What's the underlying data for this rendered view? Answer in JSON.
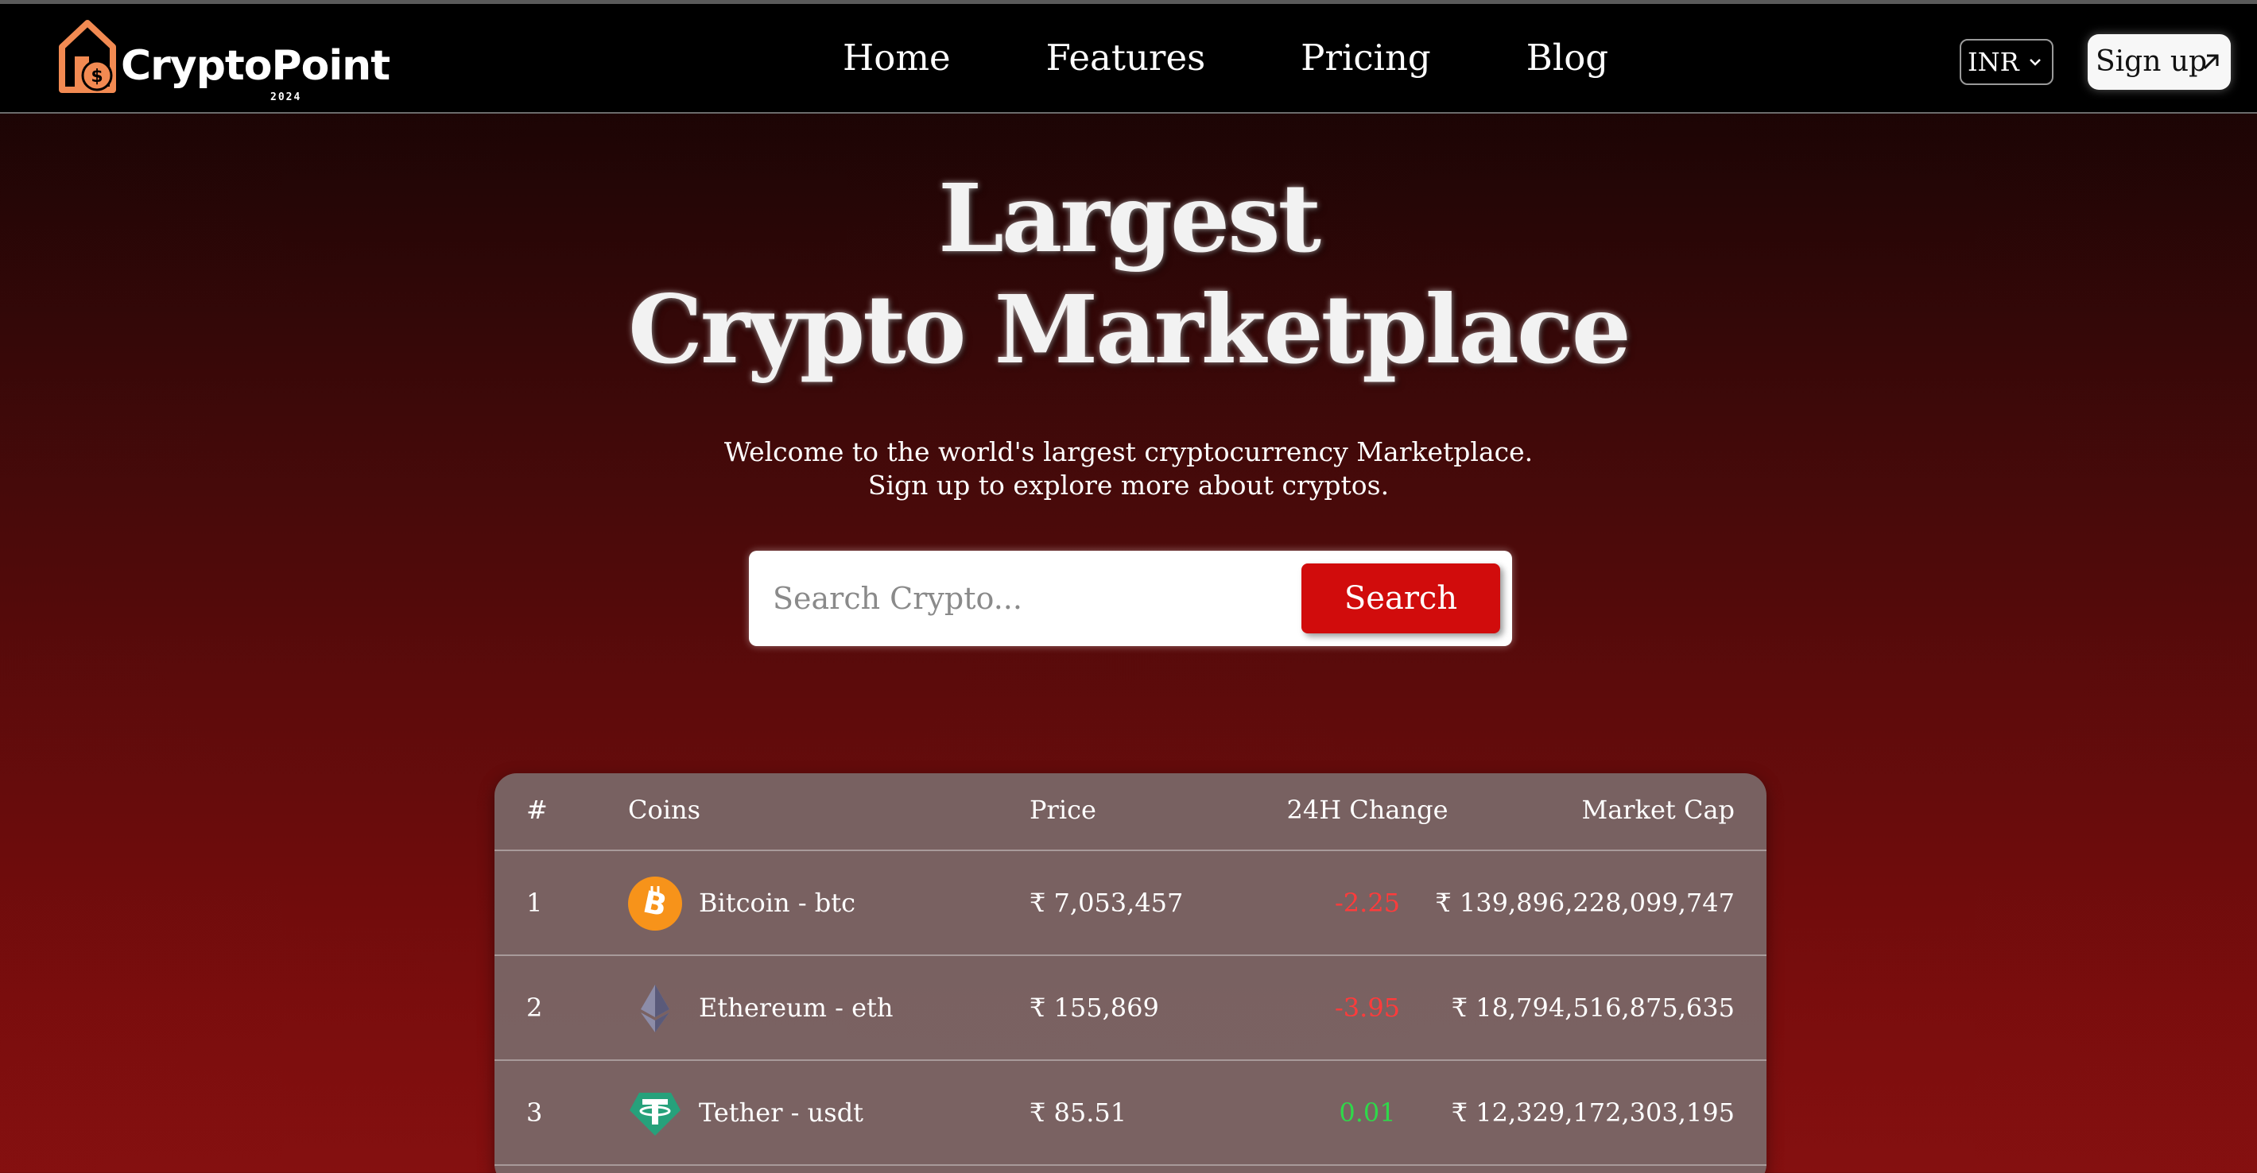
{
  "brand": {
    "name": "CryptoPoint",
    "year": "2024",
    "accent": "#f28a52"
  },
  "nav": {
    "links": [
      "Home",
      "Features",
      "Pricing",
      "Blog"
    ],
    "currency": "INR",
    "signup_label": "Sign up"
  },
  "hero": {
    "title_line1": "Largest",
    "title_line2": "Crypto Marketplace",
    "subtitle_line1": "Welcome to the world's largest cryptocurrency Marketplace.",
    "subtitle_line2": "Sign up to explore more about cryptos."
  },
  "search": {
    "placeholder": "Search Crypto...",
    "button_label": "Search",
    "button_color": "#d10c0c"
  },
  "table": {
    "headers": {
      "rank": "#",
      "coins": "Coins",
      "price": "Price",
      "change": "24H Change",
      "market_cap": "Market Cap"
    },
    "rows": [
      {
        "rank": "1",
        "name": "Bitcoin - btc",
        "price": "₹ 7,053,457",
        "change": "-2.25",
        "change_color": "#ff3b3b",
        "market_cap": "₹ 139,896,228,099,747",
        "icon": "bitcoin-icon"
      },
      {
        "rank": "2",
        "name": "Ethereum - eth",
        "price": "₹ 155,869",
        "change": "-3.95",
        "change_color": "#ff3b3b",
        "market_cap": "₹ 18,794,516,875,635",
        "icon": "ethereum-icon"
      },
      {
        "rank": "3",
        "name": "Tether - usdt",
        "price": "₹ 85.51",
        "change": "0.01",
        "change_color": "#2fd84a",
        "market_cap": "₹ 12,329,172,303,195",
        "icon": "tether-icon"
      }
    ]
  }
}
